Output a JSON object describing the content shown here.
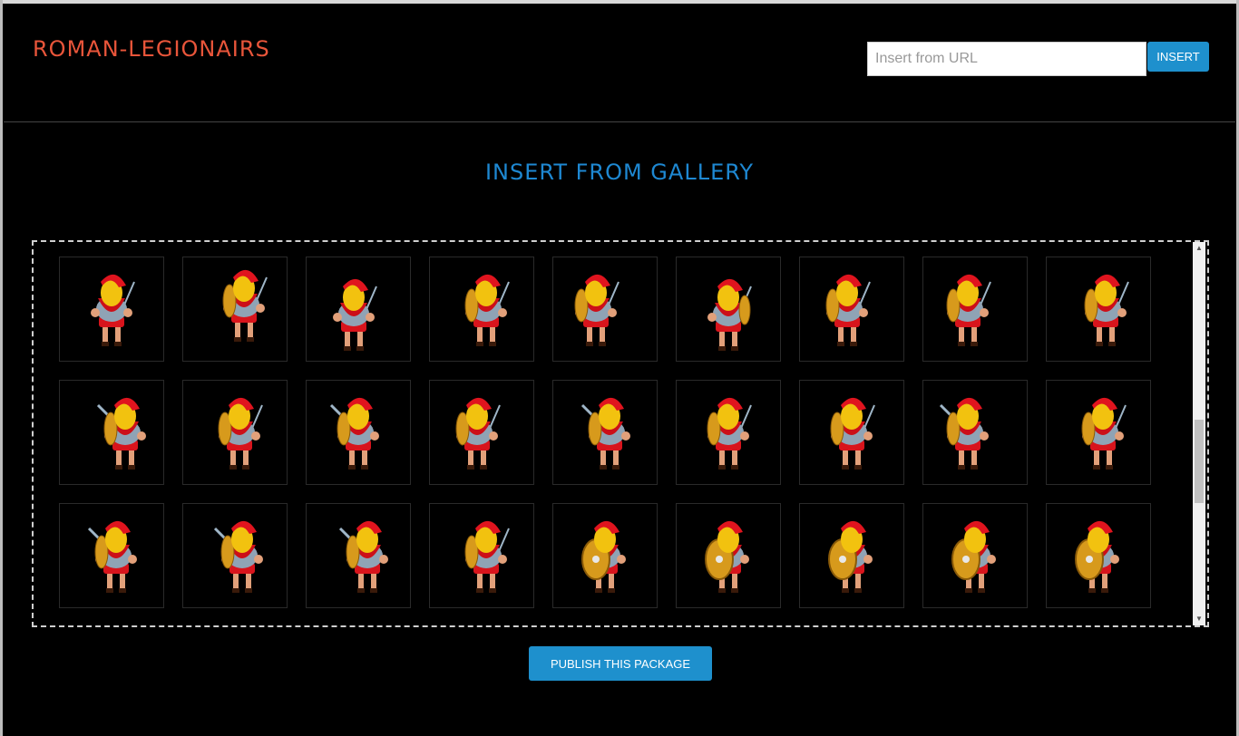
{
  "header": {
    "title": "ROMAN-LEGIONAIRS",
    "url_placeholder": "Insert from URL",
    "insert_label": "INSERT"
  },
  "gallery": {
    "title": "INSERT FROM GALLERY",
    "item_icon": "roman-legionary-sprite",
    "rows": 3,
    "columns": 9
  },
  "footer": {
    "publish_label": "PUBLISH THIS PACKAGE"
  },
  "colors": {
    "title": "#e8553a",
    "accent": "#1e88d2",
    "button": "#1e90cd"
  }
}
